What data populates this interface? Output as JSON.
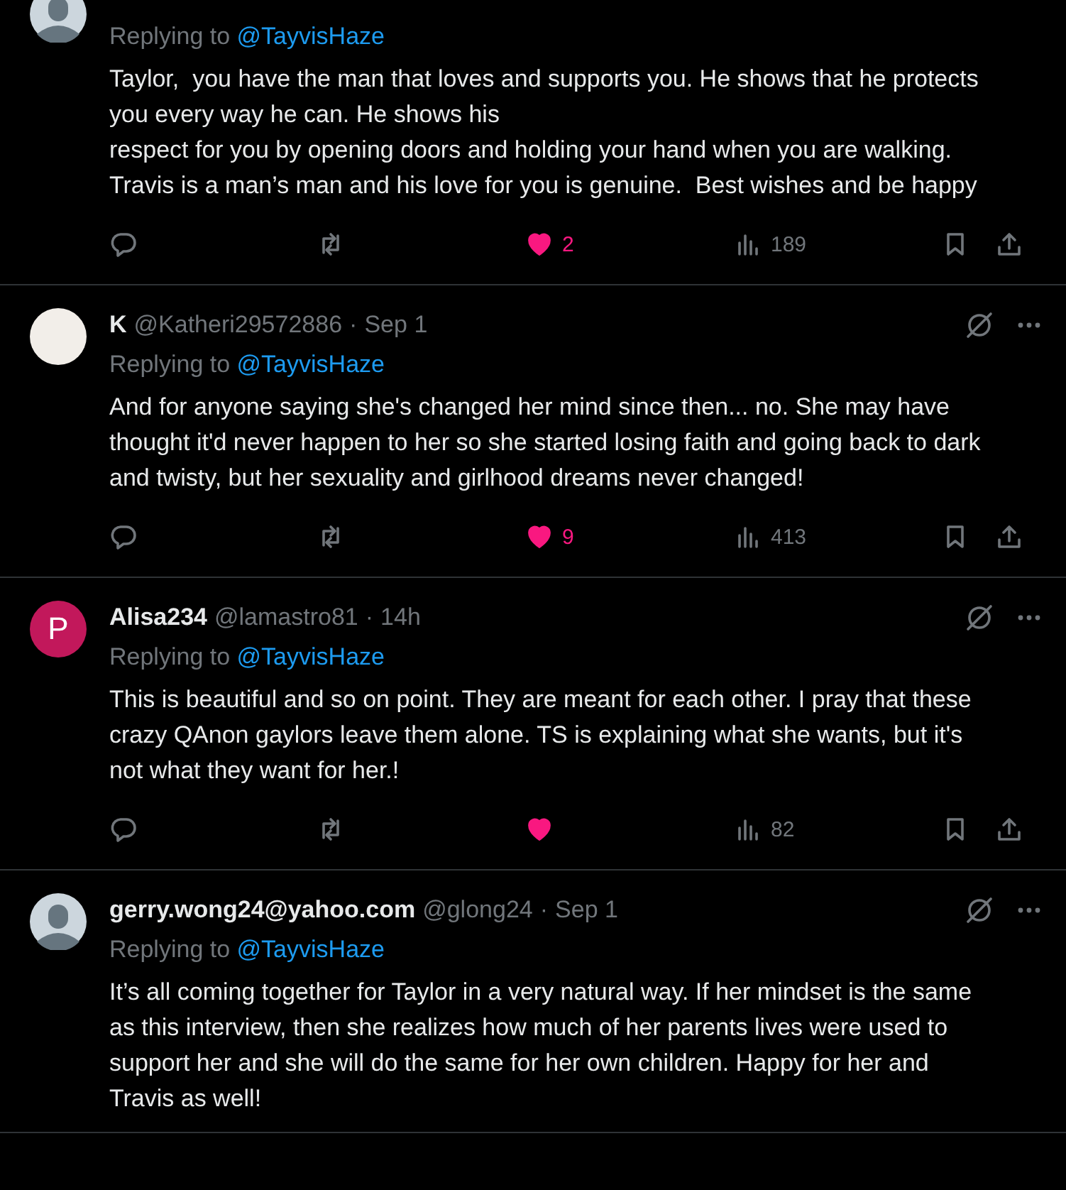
{
  "tweets": [
    {
      "avatar": {
        "kind": "default"
      },
      "replying_label": "Replying to",
      "replying_to": "@TayvisHaze",
      "text": "Taylor,  you have the man that loves and supports you. He shows that he protects  you every way he can. He shows his\nrespect for you by opening doors and holding your hand when you are walking. Travis is a man’s man and his love for you is genuine.  Best wishes and be happy",
      "liked": true,
      "likes": "2",
      "views": "189"
    },
    {
      "avatar": {
        "kind": "image"
      },
      "name": "K",
      "handle": "@Katheri29572886",
      "separator": "·",
      "time": "Sep 1",
      "replying_label": "Replying to",
      "replying_to": "@TayvisHaze",
      "text": "And for anyone saying she's changed her mind since then... no. She may have thought it'd never happen to her so she started losing faith and going back to dark and twisty, but her sexuality and girlhood dreams never changed!",
      "liked": true,
      "likes": "9",
      "views": "413"
    },
    {
      "avatar": {
        "kind": "letter",
        "letter": "P",
        "color": "#c2185b"
      },
      "name": "Alisa234",
      "handle": "@lamastro81",
      "separator": "·",
      "time": "14h",
      "replying_label": "Replying to",
      "replying_to": "@TayvisHaze",
      "text": "This is beautiful and so on point. They are meant for each other. I pray that these crazy QAnon gaylors leave them alone. TS is explaining what she wants, but it's not what they want for her.!",
      "liked": true,
      "views": "82"
    },
    {
      "avatar": {
        "kind": "default"
      },
      "name": "gerry.wong24@yahoo.com",
      "handle": "@glong24",
      "separator": "·",
      "time": "Sep 1",
      "replying_label": "Replying to",
      "replying_to": "@TayvisHaze",
      "text": "It’s all coming together for Taylor in a very natural way. If her mindset is the same as this interview, then she realizes how much of her parents lives were used to support her and she will do the same for her own children. Happy for her and Travis as well!"
    }
  ]
}
